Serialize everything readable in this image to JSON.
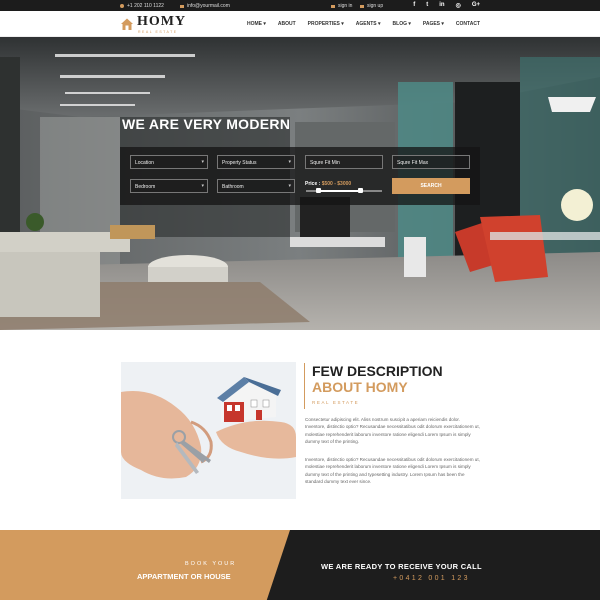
{
  "topbar": {
    "phone": "+1 202 110 1122",
    "email": "info@yourmail.com",
    "signin": "sign in",
    "signup": "sign up",
    "social": [
      {
        "label": "f",
        "icon": "facebook-icon"
      },
      {
        "label": "t",
        "icon": "twitter-icon"
      },
      {
        "label": "in",
        "icon": "linkedin-icon"
      },
      {
        "label": "◎",
        "icon": "instagram-icon"
      },
      {
        "label": "G+",
        "icon": "google-plus-icon"
      }
    ]
  },
  "brand": {
    "name": "HOMY",
    "tagline": "REAL ESTATE"
  },
  "nav": [
    {
      "label": "HOME ▾"
    },
    {
      "label": "ABOUT"
    },
    {
      "label": "PROPERTIES ▾"
    },
    {
      "label": "AGENTS ▾"
    },
    {
      "label": "BLOG ▾"
    },
    {
      "label": "PAGES ▾"
    },
    {
      "label": "CONTACT"
    }
  ],
  "hero": {
    "title": "WE ARE VERY MODERN"
  },
  "search": {
    "location": "Location",
    "property_status": "Property Status",
    "sqft_min": "Squre Fit Min",
    "sqft_max": "Squre Fit Max",
    "bedroom": "Bedroom",
    "bathroom": "Bathroom",
    "price_label": "Price :",
    "price_range": "$500 - $3000",
    "button": "SEARCH",
    "price_min": 500,
    "price_max": 3000
  },
  "about": {
    "title_line1": "FEW DESCRIPTION",
    "title_line2": "ABOUT HOMY",
    "subtitle": "REAL ESTATE",
    "para1": "Consectetur adipiscing elit. Aliss nostrum suscipit a aperiam reiciendis dolor. Inventore, distinctio optio? Recusandae necessitatibus odit dolorum exercitationem ut, molestiae reprehenderit laborum inventore ratione eligendi Lorem Ipsum is simply dummy text of the printing.",
    "para2": "Inventore, distinctio optio? Recusandae necessitatibus odit dolorum exercitationem ut, molestiae reprehenderit laborum inventore ratione eligendi Lorem Ipsum is simply dummy text of the printing and typesetting industry. Lorem Ipsum has been the standard dummy text ever since."
  },
  "cta": {
    "left_kicker": "BOOK YOUR",
    "left_title": "APPARTMENT OR HOUSE",
    "right_title": "WE ARE READY TO RECEIVE YOUR CALL",
    "phone": "+0412 001 123"
  },
  "colors": {
    "accent": "#d39b5e",
    "dark": "#1c1c1c"
  }
}
